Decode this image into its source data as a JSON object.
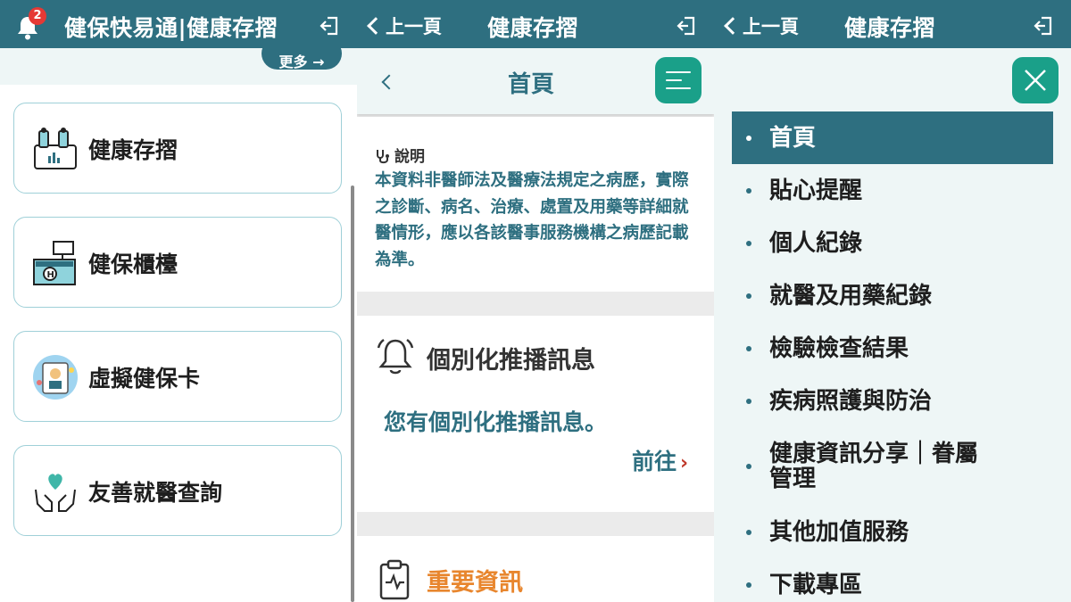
{
  "panel1": {
    "notification_count": "2",
    "title": "健保快易通|健康存摺",
    "more_label": "更多 →",
    "cards": [
      {
        "label": "健康存摺",
        "icon": "health-passbook-icon"
      },
      {
        "label": "健保櫃檯",
        "icon": "counter-icon"
      },
      {
        "label": "虛擬健保卡",
        "icon": "virtual-card-icon"
      },
      {
        "label": "友善就醫查詢",
        "icon": "heart-hands-icon"
      }
    ]
  },
  "panel2": {
    "back_label": "上一頁",
    "title": "健康存摺",
    "home_title": "首頁",
    "note_heading": "說明",
    "note_body": "本資料非醫師法及醫療法規定之病歷，實際之診斷、病名、治療、處置及用藥等詳細就醫情形，應以各該醫事服務機構之病歷記載為準。",
    "push_title": "個別化推播訊息",
    "push_message": "您有個別化推播訊息。",
    "goto_label": "前往",
    "important_title": "重要資訊"
  },
  "panel3": {
    "back_label": "上一頁",
    "title": "健康存摺",
    "menu_items": [
      "首頁",
      "貼心提醒",
      "個人紀錄",
      "就醫及用藥紀錄",
      "檢驗檢查結果",
      "疾病照護與防治",
      "健康資訊分享｜眷屬",
      "管理",
      "其他加值服務",
      "下載專區"
    ]
  },
  "colors": {
    "header": "#2e6f80",
    "accent_teal": "#1aa089",
    "important_orange": "#e8862e",
    "badge_red": "#e53935"
  }
}
